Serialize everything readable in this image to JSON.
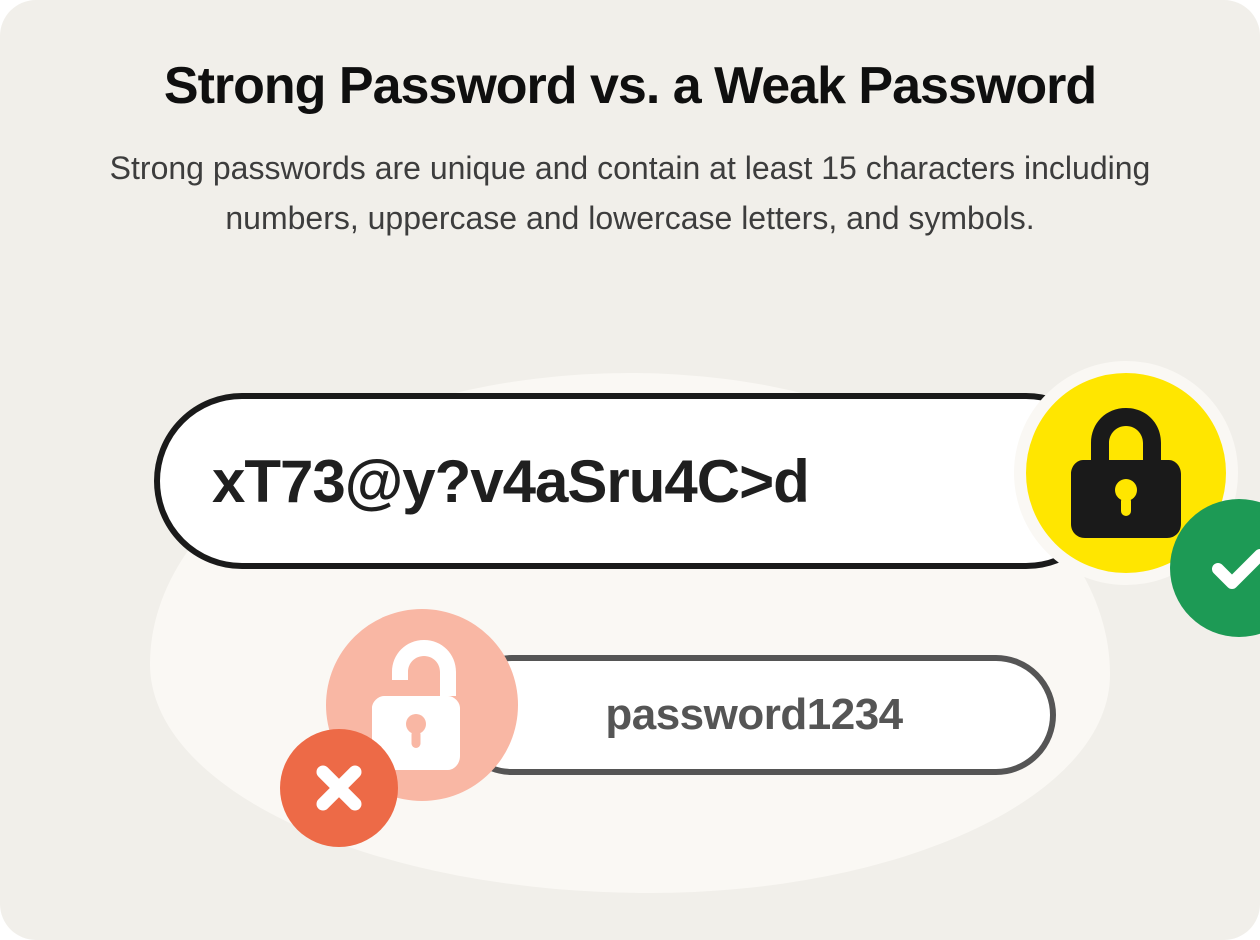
{
  "header": {
    "title": "Strong Password vs. a Weak Password",
    "subtitle": "Strong passwords are unique and contain at least 15 characters including numbers, uppercase and lowercase letters, and symbols."
  },
  "examples": {
    "strong": {
      "password": "xT73@y?v4aSru4C>d"
    },
    "weak": {
      "password": "password1234"
    }
  },
  "colors": {
    "card_bg": "#f1efea",
    "blob_bg": "#faf8f4",
    "strong_border": "#1a1a1a",
    "weak_border": "#555555",
    "lock_strong_bg": "#ffe600",
    "check_bg": "#1d9a55",
    "lock_weak_bg": "#f9b7a4",
    "x_bg": "#ed6a47"
  }
}
